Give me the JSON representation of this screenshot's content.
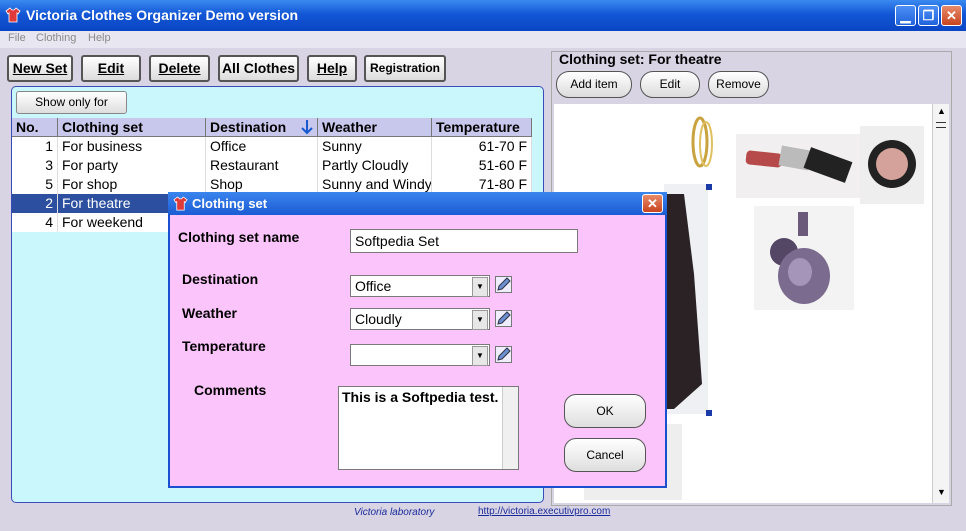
{
  "window": {
    "title": "Victoria Clothes Organizer Demo version",
    "minimize": "▁",
    "maximize": "❐",
    "close": "✕"
  },
  "menu": [
    "File",
    "Clothing",
    "Help"
  ],
  "toolbar": {
    "new_set": "New Set",
    "edit": "Edit",
    "delete": "Delete",
    "all_clothes": "All Clothes",
    "help": "Help",
    "registration": "Registration"
  },
  "left": {
    "show_only_for": "Show only for",
    "columns": [
      "No.",
      "Clothing set",
      "Destination",
      "Weather",
      "Temperature"
    ],
    "rows": [
      {
        "no": "1",
        "set": "For business",
        "destination": "Office",
        "weather": "Sunny",
        "temperature": "61-70 F"
      },
      {
        "no": "3",
        "set": "For party",
        "destination": "Restaurant",
        "weather": "Partly Cloudly",
        "temperature": "51-60 F"
      },
      {
        "no": "5",
        "set": "For shop",
        "destination": "Shop",
        "weather": "Sunny and Windy",
        "temperature": "71-80 F"
      },
      {
        "no": "2",
        "set": "For theatre",
        "destination": "",
        "weather": "",
        "temperature": ""
      },
      {
        "no": "4",
        "set": "For weekend",
        "destination": "",
        "weather": "",
        "temperature": ""
      }
    ],
    "selected_row_index": 3
  },
  "right": {
    "title": "Clothing set: For theatre",
    "add_item": "Add item",
    "edit": "Edit",
    "remove": "Remove"
  },
  "status": {
    "left_text": "Victoria laboratory",
    "link_text": "http://victoria.executivpro.com"
  },
  "dialog": {
    "title": "Clothing set",
    "close": "✕",
    "name_label": "Clothing set name",
    "name_value": "Softpedia Set",
    "destination_label": "Destination",
    "destination_value": "Office",
    "weather_label": "Weather",
    "weather_value": "Cloudly",
    "temperature_label": "Temperature",
    "temperature_value": "",
    "comments_label": "Comments",
    "comments_value": "This is a Softpedia test.",
    "ok": "OK",
    "cancel": "Cancel"
  },
  "colors": {
    "titlebar": "#1357d6",
    "left_panel_bg": "#c9f7fb",
    "dialog_bg": "#fbc4fb",
    "selected_row": "#2c4fa0"
  },
  "icons": [
    "app-tshirt-icon",
    "sort-arrow-icon",
    "edit-pencil-icon",
    "chevron-down-icon"
  ]
}
